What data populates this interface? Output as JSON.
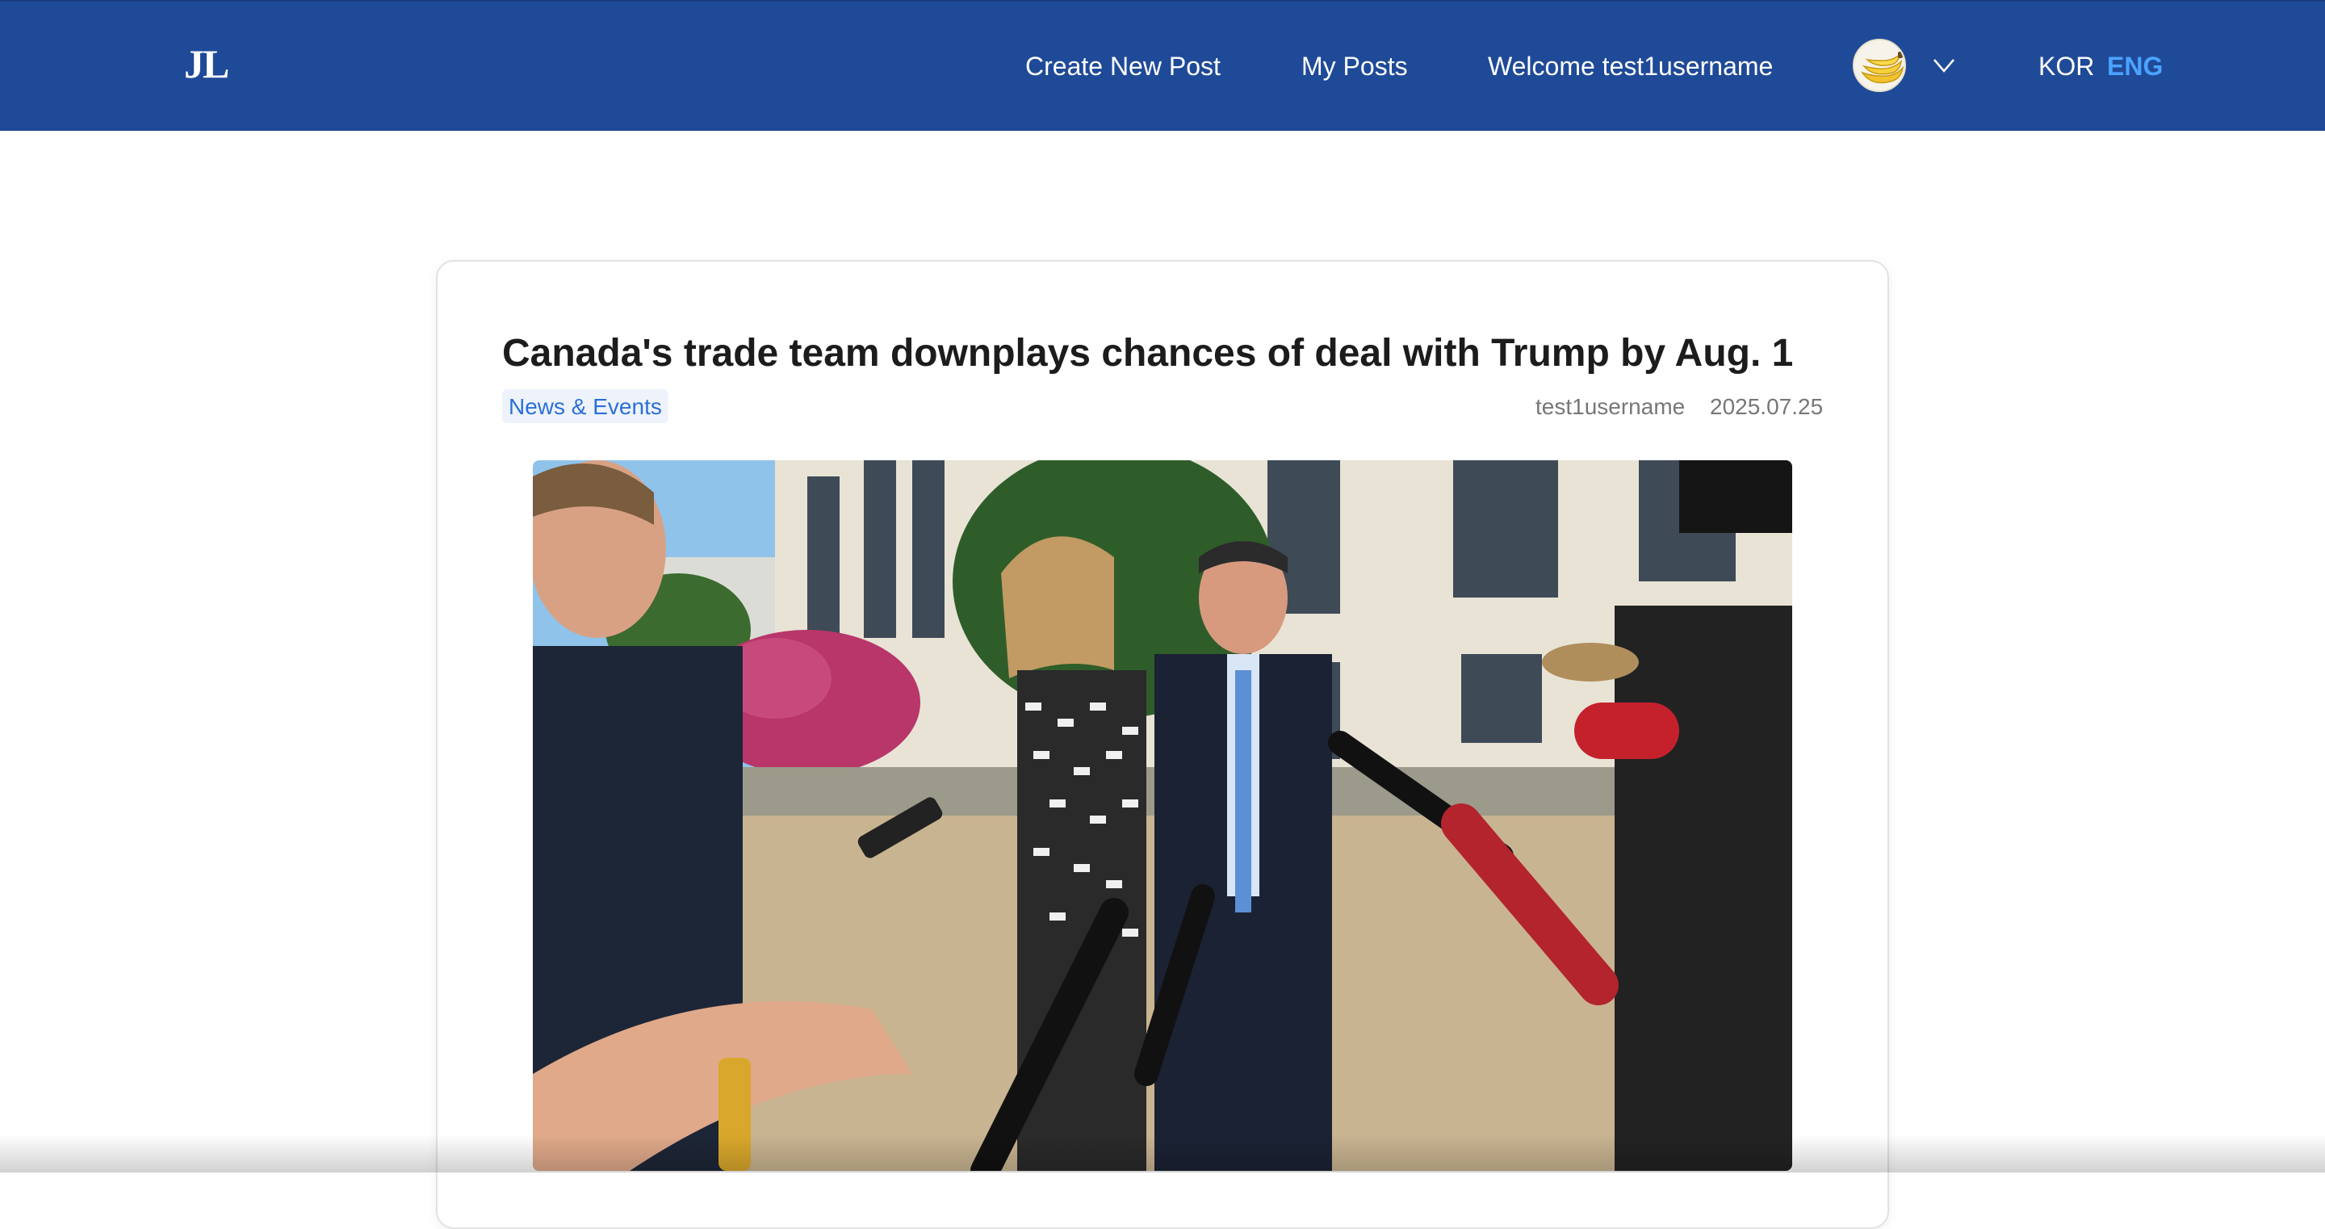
{
  "header": {
    "logo": "JL",
    "nav": {
      "create_post": "Create New Post",
      "my_posts": "My Posts",
      "welcome": "Welcome test1username"
    },
    "avatar_icon": "banana-avatar-icon",
    "menu_icon": "chevron-down-icon",
    "languages": {
      "kor": "KOR",
      "eng": "ENG",
      "active": "ENG"
    }
  },
  "post": {
    "title": "Canada's trade team downplays chances of deal with Trump by Aug. 1",
    "category": "News & Events",
    "author": "test1username",
    "date": "2025.07.25",
    "image_alt": "Canada's trade team speaking to reporters outdoors"
  },
  "colors": {
    "navbar": "#1f4a97",
    "active_language": "#4aa3ff",
    "category_text": "#2b6fd6"
  }
}
